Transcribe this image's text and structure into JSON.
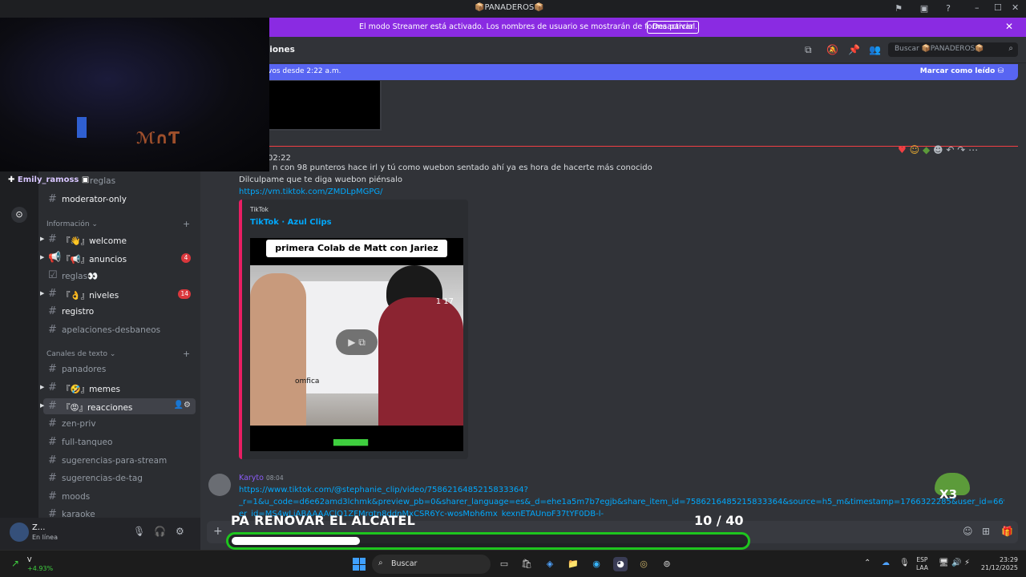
{
  "window": {
    "title": "📦PANADEROS📦"
  },
  "banner": {
    "text": "El modo Streamer está activado. Los nombres de usuario se mostrarán de forma parcial.",
    "button": "Desactivar"
  },
  "header": {
    "channel_partial": "ciones",
    "search_placeholder": "Buscar 📦PANADEROS📦"
  },
  "new_messages": {
    "text": "vos desde 2:22 a.m.",
    "mark_read": "Marcar como leído"
  },
  "sidebar": {
    "top_partial": "reglas",
    "moderator": "moderator-only",
    "cat_info": "Información",
    "cat_text": "Canales de texto",
    "channels": [
      {
        "label": "『👋』welcome",
        "badge": ""
      },
      {
        "label": "『📢』anuncios",
        "badge": "4"
      },
      {
        "label": "reglas👀",
        "badge": ""
      },
      {
        "label": "『👌』niveles",
        "badge": "14"
      },
      {
        "label": "registro",
        "badge": ""
      },
      {
        "label": "apelaciones-desbaneos",
        "badge": ""
      },
      {
        "label": "panadores",
        "badge": ""
      },
      {
        "label": "『🤣』memes",
        "badge": ""
      },
      {
        "label": "『😡』reacciones",
        "badge": ""
      },
      {
        "label": "zen-priv",
        "badge": ""
      },
      {
        "label": "full-tanqueo",
        "badge": ""
      },
      {
        "label": "sugerencias-para-stream",
        "badge": ""
      },
      {
        "label": "sugerencias-de-tag",
        "badge": ""
      },
      {
        "label": "moods",
        "badge": ""
      },
      {
        "label": "karaoke",
        "badge": ""
      }
    ]
  },
  "user": {
    "name": "Z...",
    "status": "En línea"
  },
  "message1": {
    "time": "02:22",
    "line1": "n con 98 punteros hace irl y tú como wuebon sentado ahí ya es hora  de hacerte más conocido",
    "line2": "Dilculpame que te diga wuebon  piénsalo",
    "link": "https://vm.tiktok.com/ZMDLpMGPG/"
  },
  "embed": {
    "provider": "TikTok",
    "title": "TikTok · Azul Clips",
    "caption": "primera Colab de Matt con Jariez",
    "counter": "1  17",
    "brand": "omfica"
  },
  "message2": {
    "author": "Karyto",
    "time": "08:04",
    "link1": "https://www.tiktok.com/@stephanie_clip/video/7586216485215833364?",
    "link2": "_r=1&u_code=d6e62amd3lchmk&preview_pb=0&sharer_language=es&_d=ehe1a5m7b7egjb&share_item_id=7586216485215833364&source=h5_m&timestamp=1766322285&user_id=669755280971117&sec_us",
    "link3": "er_id=MS4wLjABAAAAClO1ZFMrgtn8ddnMxCSR6Yc-wosMph6mx_kexnETAUnpF37tYF0DB-l-"
  },
  "overlay": {
    "chatter": "Emily_ramoss",
    "goal_title": "PA RENOVAR EL ALCATEL",
    "goal_count": "10  / 40",
    "goal_progress": 0.25,
    "emote_text": "X3"
  },
  "taskbar": {
    "ticker": "V",
    "change": "+4.93%",
    "search": "Buscar",
    "lang1": "ESP",
    "lang2": "LAA",
    "time": "23:29",
    "date": "21/12/2025"
  }
}
